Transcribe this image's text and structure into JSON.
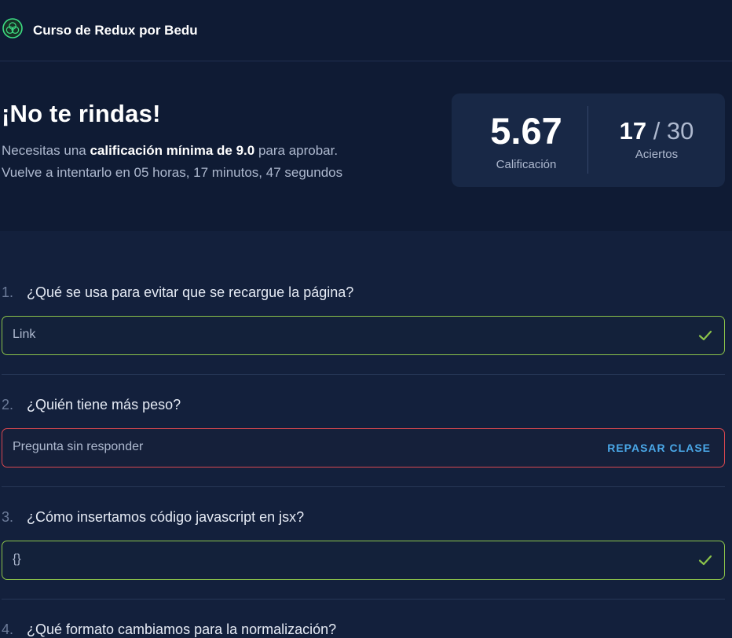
{
  "header": {
    "course_title": "Curso de Redux por Bedu",
    "logo_icon": "bedu-logo-icon"
  },
  "result": {
    "title": "¡No te rindas!",
    "line1_prefix": "Necesitas una ",
    "line1_bold": "calificación mínima de 9.0",
    "line1_suffix": " para aprobar.",
    "line2": "Vuelve a intentarlo en 05 horas, 17 minutos, 47 segundos",
    "score": "5.67",
    "score_label": "Calificación",
    "correct": "17",
    "total": " / 30",
    "hits_label": "Aciertos"
  },
  "questions": [
    {
      "number": "1.",
      "text": "¿Qué se usa para evitar que se recargue la página?",
      "answer": "Link",
      "status": "correct"
    },
    {
      "number": "2.",
      "text": "¿Quién tiene más peso?",
      "answer": "Pregunta sin responder",
      "status": "wrong",
      "action_label": "REPASAR CLASE"
    },
    {
      "number": "3.",
      "text": "¿Cómo insertamos código javascript en jsx?",
      "answer": "{}",
      "status": "correct"
    },
    {
      "number": "4.",
      "text": "¿Qué formato cambiamos para la normalización?"
    }
  ],
  "colors": {
    "correct": "#8bc34a",
    "wrong": "#d8474f",
    "link": "#4aa8e8",
    "background": "#13203c"
  }
}
